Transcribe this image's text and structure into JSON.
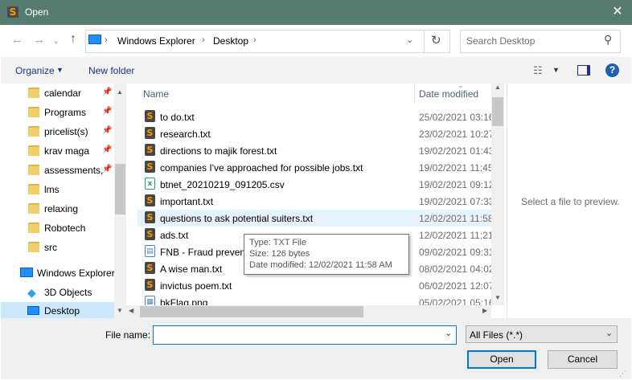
{
  "window": {
    "title": "Open",
    "app_icon": "sublime-text-icon"
  },
  "address": {
    "crumbs": [
      "Windows Explorer",
      "Desktop"
    ],
    "sep": "›"
  },
  "search": {
    "placeholder": "Search Desktop"
  },
  "toolbar": {
    "organize": "Organize",
    "new_folder": "New folder",
    "help": "?"
  },
  "nav": {
    "items": [
      {
        "label": "calendar",
        "pinned": true
      },
      {
        "label": "Programs",
        "pinned": true
      },
      {
        "label": "pricelist(s)",
        "pinned": true
      },
      {
        "label": "krav maga",
        "pinned": true
      },
      {
        "label": "assessments,",
        "pinned": true
      },
      {
        "label": "lms",
        "pinned": false
      },
      {
        "label": "relaxing",
        "pinned": false
      },
      {
        "label": "Robotech",
        "pinned": false
      },
      {
        "label": "src",
        "pinned": false
      }
    ],
    "windows_explorer": "Windows Explorer",
    "objects_3d": "3D Objects",
    "desktop": "Desktop"
  },
  "files": {
    "col_name": "Name",
    "col_date": "Date modified",
    "rows": [
      {
        "name": "to do.txt",
        "date": "25/02/2021 03:16",
        "icon": "subl"
      },
      {
        "name": "research.txt",
        "date": "23/02/2021 10:27",
        "icon": "subl"
      },
      {
        "name": "directions to majik forest.txt",
        "date": "19/02/2021 01:43",
        "icon": "subl"
      },
      {
        "name": "companies I've approached for possible jobs.txt",
        "date": "19/02/2021 11:45",
        "icon": "subl"
      },
      {
        "name": "btnet_20210219_091205.csv",
        "date": "19/02/2021 09:12",
        "icon": "csv"
      },
      {
        "name": "important.txt",
        "date": "19/02/2021 07:33",
        "icon": "subl"
      },
      {
        "name": "questions to ask potential suiters.txt",
        "date": "12/02/2021 11:58",
        "icon": "subl"
      },
      {
        "name": "ads.txt",
        "date": "12/02/2021 11:21",
        "icon": "subl"
      },
      {
        "name": "FNB - Fraud prevent",
        "date": "09/02/2021 09:31",
        "icon": "pdf"
      },
      {
        "name": "A wise man.txt",
        "date": "08/02/2021 04:02",
        "icon": "subl"
      },
      {
        "name": "invictus poem.txt",
        "date": "06/02/2021 12:07",
        "icon": "subl"
      },
      {
        "name": "bkFlag.png",
        "date": "05/02/2021 05:16",
        "icon": "png"
      }
    ]
  },
  "tooltip": {
    "type": "Type: TXT File",
    "size": "Size: 126 bytes",
    "modified": "Date modified: 12/02/2021 11:58 AM"
  },
  "preview": {
    "text": "Select a file to preview."
  },
  "bottom": {
    "filename_label": "File name:",
    "filename_value": "",
    "filter": "All Files (*.*)",
    "open": "Open",
    "cancel": "Cancel"
  },
  "colors": {
    "titlebar": "#567b6f",
    "accent": "#0078d7",
    "selected": "#cce8ff",
    "hover": "#e5f3ff"
  }
}
